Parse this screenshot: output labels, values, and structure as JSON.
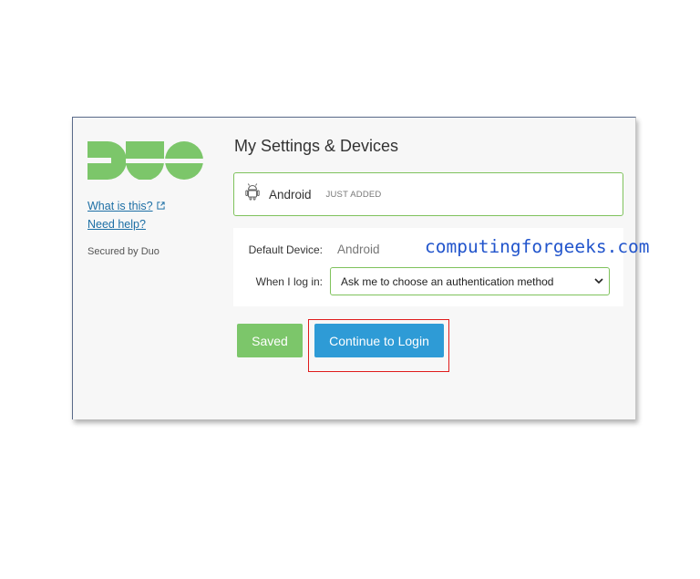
{
  "sidebar": {
    "logo_text": "DUO",
    "what_is_this": "What is this?",
    "need_help": "Need help?",
    "secured_by": "Secured by Duo"
  },
  "main": {
    "title": "My Settings & Devices",
    "device": {
      "icon": "android-icon",
      "name": "Android",
      "badge": "JUST ADDED"
    },
    "settings": {
      "default_device_label": "Default Device:",
      "default_device_value": "Android",
      "when_login_label": "When I log in:",
      "when_login_selected": "Ask me to choose an authentication method"
    },
    "buttons": {
      "saved": "Saved",
      "continue": "Continue to Login"
    }
  },
  "watermark": "computingforgeeks.com",
  "colors": {
    "duo_green": "#7cc66a",
    "primary_blue": "#2e9bd6",
    "highlight_red": "#e01b1b",
    "link_blue": "#1d6fa5",
    "watermark_blue": "#2255cc"
  }
}
